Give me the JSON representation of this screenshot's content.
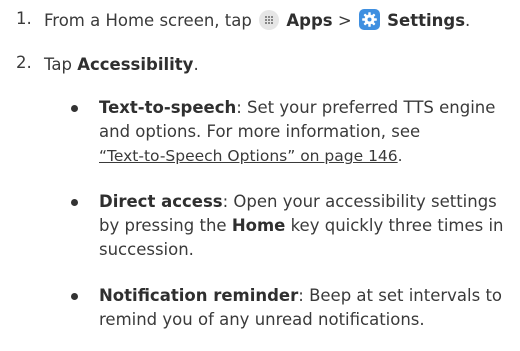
{
  "step1": {
    "number": "1.",
    "text": "From a Home screen, tap",
    "apps_label": "Apps",
    "separator": ">",
    "settings_label": "Settings",
    "end": "."
  },
  "step2": {
    "number": "2.",
    "text": "Tap",
    "accessibility_label": "Accessibility",
    "end": "."
  },
  "bullets": [
    {
      "term": "Text-to-speech",
      "line1": ": Set your preferred TTS engine",
      "line2": "and options. For more information, see",
      "link": "“Text-to-Speech Options” on page 146",
      "line3_end": "."
    },
    {
      "term": "Direct access",
      "line1": ": Open your accessibility settings",
      "line2_a": "by pressing the",
      "line2_key": "Home",
      "line2_b": "key quickly three times in",
      "line3": "succession."
    },
    {
      "term": "Notification reminder",
      "line1": ": Beep at set intervals to",
      "line2": "remind you of any unread notifications."
    }
  ],
  "icons": {
    "apps": "apps-grid-icon",
    "settings": "settings-gear-icon",
    "settings_color": "#3f8fe0"
  }
}
